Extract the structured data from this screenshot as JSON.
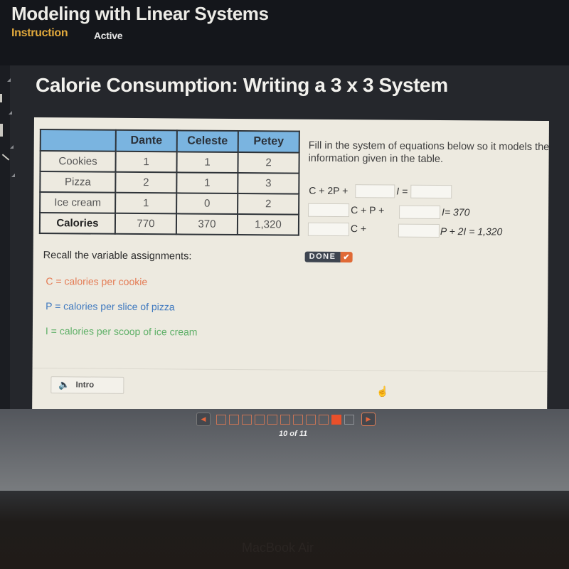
{
  "app": {
    "title": "Modeling with Linear Systems",
    "tabs": [
      {
        "label": "Instruction",
        "state": "selected",
        "color": "#e2a93c"
      },
      {
        "label": "Active",
        "state": "normal"
      }
    ]
  },
  "lesson": {
    "title": "Calorie Consumption: Writing a 3 x 3 System"
  },
  "table": {
    "columns": [
      "",
      "Dante",
      "Celeste",
      "Petey"
    ],
    "rows": [
      {
        "label": "Cookies",
        "values": [
          "1",
          "1",
          "2"
        ]
      },
      {
        "label": "Pizza",
        "values": [
          "2",
          "1",
          "3"
        ]
      },
      {
        "label": "Ice cream",
        "values": [
          "1",
          "0",
          "2"
        ]
      },
      {
        "label": "Calories",
        "values": [
          "770",
          "370",
          "1,320"
        ]
      }
    ],
    "header_color": "#7ab4e0"
  },
  "instructions": "Fill in the system of equations below so it models the information given in the table.",
  "equations": {
    "eq1": {
      "part1": "C + 2P +",
      "part2": "I =",
      "blanks": [
        "",
        ""
      ]
    },
    "eq2": {
      "part1": "C + P +",
      "part2": "I= 370",
      "blanks": [
        "",
        ""
      ]
    },
    "eq3": {
      "part1": "C +",
      "part2": "P + 2I = 1,320",
      "blanks": [
        "",
        ""
      ]
    }
  },
  "done_button": {
    "label": "DONE",
    "check": "✔"
  },
  "recall": {
    "heading": "Recall the variable assignments:",
    "variables": [
      {
        "text": "C = calories per cookie",
        "color": "#e47c55"
      },
      {
        "text": "P = calories per slice of pizza",
        "color": "#3f79bf"
      },
      {
        "text": "I = calories per scoop of ice cream",
        "color": "#5fb068"
      }
    ]
  },
  "intro_button": {
    "label": "Intro",
    "icon": "speaker-icon"
  },
  "pager": {
    "current": 10,
    "total": 11,
    "label": "10 of 11",
    "accent": "#e9502a"
  },
  "device": {
    "label": "MacBook Air"
  }
}
